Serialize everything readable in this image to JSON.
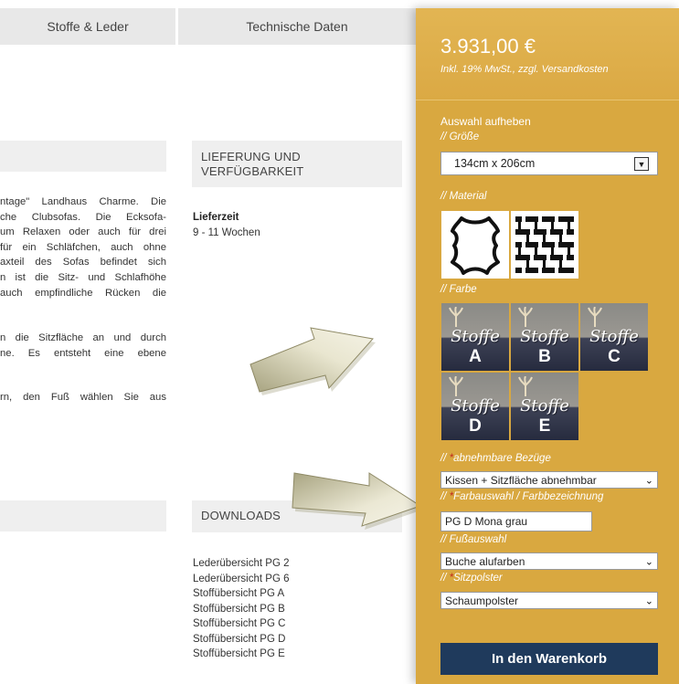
{
  "tabs": {
    "stoffe": "Stoffe & Leder",
    "technik": "Technische Daten"
  },
  "description": {
    "lines": [
      "ntage\" Landhaus Charme. Die",
      "che Clubsofas. Die Ecksofa-",
      "um Relaxen oder auch für drei",
      "für ein Schläfchen, auch ohne",
      "axteil des Sofas befindet sich",
      "n ist die Sitz- und Schlafhöhe",
      "auch empfindliche Rücken die"
    ],
    "lines2": [
      "n die Sitzfläche an und durch",
      "ne. Es entsteht eine ebene"
    ],
    "lines3": [
      "rn, den Fuß wählen Sie aus"
    ]
  },
  "lieferung": {
    "heading_line1": "LIEFERUNG UND",
    "heading_line2": "VERFÜGBARKEIT",
    "label": "Lieferzeit",
    "value": "9 - 11 Wochen"
  },
  "downloads": {
    "heading": "DOWNLOADS",
    "items": [
      "Lederübersicht PG 2",
      "Lederübersicht PG 6",
      "Stoffübersicht PG A",
      "Stoffübersicht PG B",
      "Stoffübersicht PG C",
      "Stoffübersicht PG D",
      "Stoffübersicht PG E"
    ]
  },
  "product": {
    "price": "3.931,00 €",
    "price_note": "Inkl. 19% MwSt., zzgl. Versandkosten",
    "reset": "Auswahl aufheben",
    "size_label": "// Größe",
    "size_value": "134cm x 206cm",
    "material_label": "// Material",
    "farbe_label": "// Farbe",
    "fabric_word": "Stoffe",
    "fabrics": [
      "A",
      "B",
      "C",
      "D",
      "E"
    ],
    "bezuege_label_prefix": "// ",
    "bezuege_label_req": "*",
    "bezuege_label": "abnehmbare Bezüge",
    "bezuege_value": "Kissen + Sitzfläche abnehmbar",
    "farbauswahl_label_prefix": "// ",
    "farbauswahl_label_req": "*",
    "farbauswahl_label": "Farbauswahl / Farbbezeichnung",
    "farbauswahl_value": "PG D Mona grau",
    "fuss_label": "// Fußauswahl",
    "fuss_value": "Buche alufarben",
    "sitz_label_prefix": "// ",
    "sitz_label_req": "*",
    "sitz_label": "Sitzpolster",
    "sitz_value": "Schaumpolster",
    "cart_button": "In den Warenkorb"
  },
  "colors": {
    "panel": "#d9a840",
    "cart_button": "#1f3a5c",
    "required": "#c0281f"
  }
}
